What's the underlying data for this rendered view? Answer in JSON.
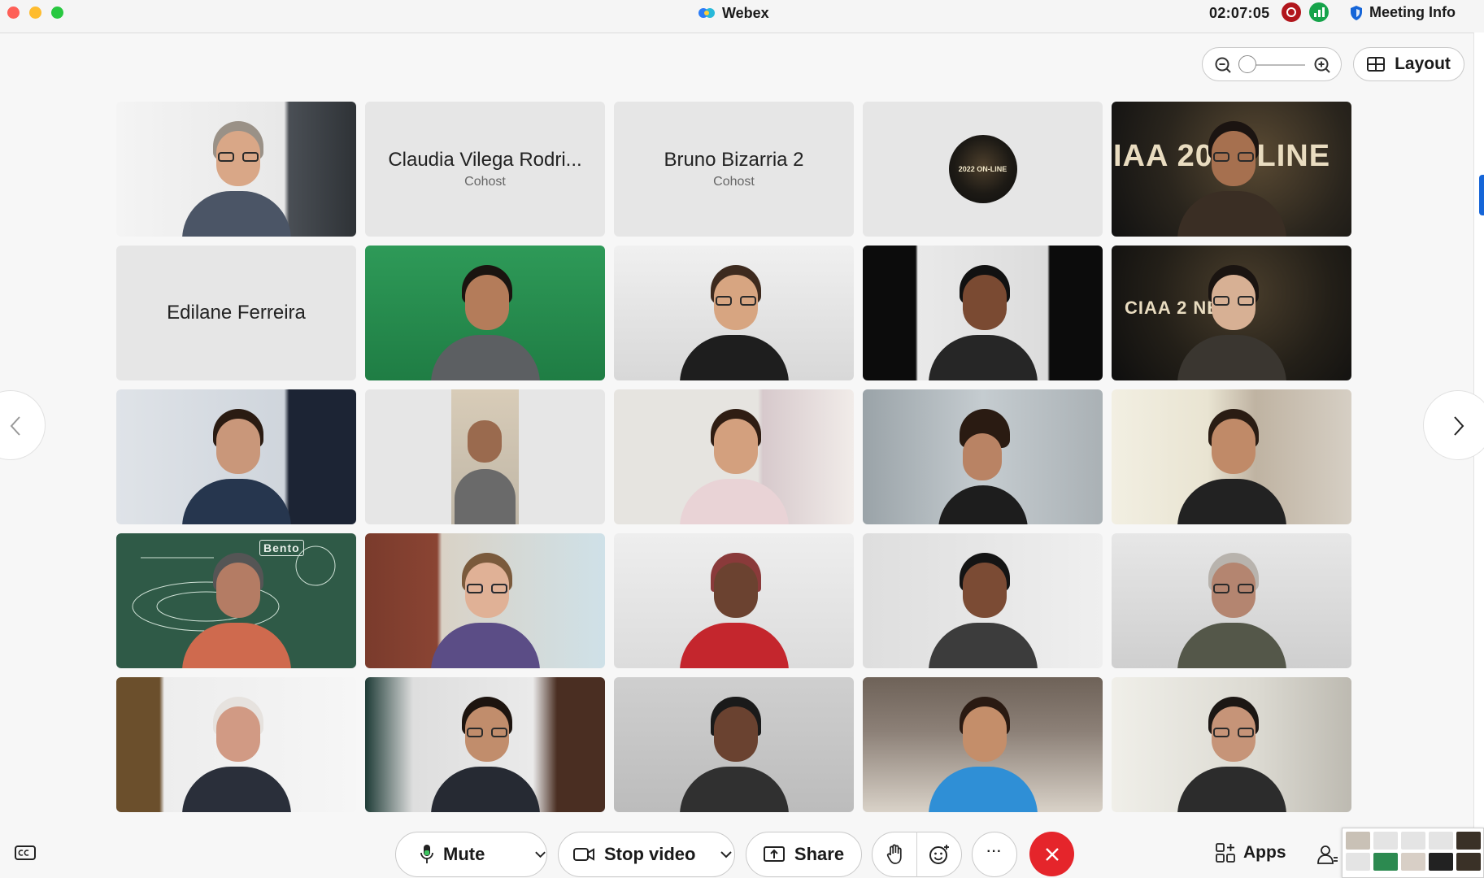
{
  "window": {
    "title": "Webex",
    "time": "02:07:05",
    "meeting_info_label": "Meeting Info",
    "layout_label": "Layout"
  },
  "tiles": [
    {
      "type": "video",
      "participant": "video-1"
    },
    {
      "type": "name",
      "name": "Claudia Vilega Rodri...",
      "role": "Cohost"
    },
    {
      "type": "name",
      "name": "Bruno Bizarria 2",
      "role": "Cohost"
    },
    {
      "type": "avatar",
      "avatar_text": "2022 ON-LINE"
    },
    {
      "type": "video",
      "banner_text": "IAA 20   N-LINE"
    },
    {
      "type": "name",
      "name": "Edilane Ferreira",
      "role": ""
    },
    {
      "type": "video"
    },
    {
      "type": "video"
    },
    {
      "type": "video"
    },
    {
      "type": "video",
      "banner_text": "CIAA 2        NE"
    },
    {
      "type": "video"
    },
    {
      "type": "video"
    },
    {
      "type": "video"
    },
    {
      "type": "video"
    },
    {
      "type": "video"
    },
    {
      "type": "video",
      "board_text": "Bento"
    },
    {
      "type": "video"
    },
    {
      "type": "video"
    },
    {
      "type": "video"
    },
    {
      "type": "video"
    },
    {
      "type": "video"
    },
    {
      "type": "video"
    },
    {
      "type": "video"
    },
    {
      "type": "video"
    },
    {
      "type": "video"
    }
  ],
  "toolbar": {
    "mute_label": "Mute",
    "stop_video_label": "Stop video",
    "share_label": "Share",
    "more_label": "···",
    "apps_label": "Apps"
  },
  "icons": {
    "app_logo": "webex-logo-icon",
    "recording": "recording-icon",
    "stats": "network-stats-icon",
    "shield": "shield-icon",
    "zoom_out": "zoom-out-icon",
    "zoom_in": "zoom-in-icon",
    "layout": "grid-layout-icon",
    "prev": "chevron-left-icon",
    "next": "chevron-right-icon",
    "captions": "closed-captions-icon",
    "mic": "microphone-icon",
    "camera": "camera-icon",
    "share": "share-screen-icon",
    "raise_hand": "raise-hand-icon",
    "reaction": "emoji-reaction-icon",
    "end": "end-call-icon",
    "apps": "apps-icon",
    "participants": "participants-icon"
  },
  "colors": {
    "end_call": "#e5252b",
    "recording": "#b1161c",
    "stats": "#16a34a",
    "accent": "#1565d8"
  }
}
